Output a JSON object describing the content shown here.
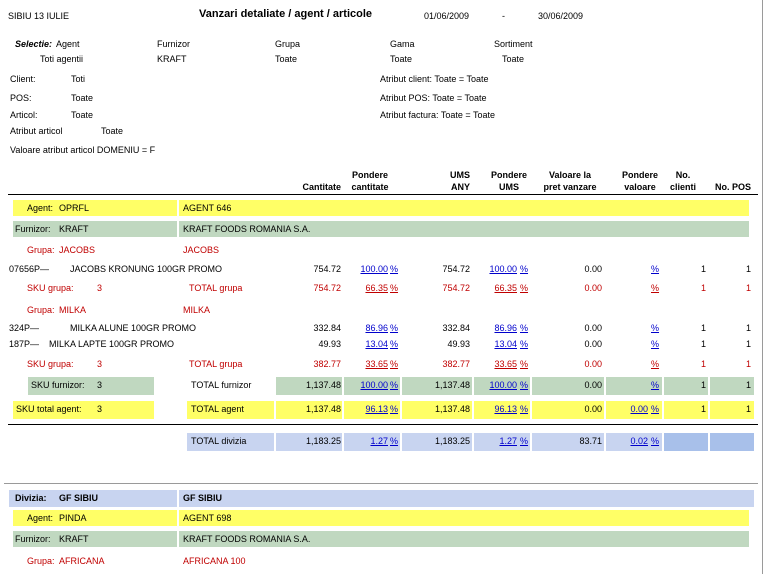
{
  "header": {
    "company": "SIBIU 13 IULIE",
    "title": "Vanzari detaliate / agent / articole",
    "date_from": "01/06/2009",
    "dash": "-",
    "date_to": "30/06/2009"
  },
  "selection": {
    "label": "Selectie:",
    "cols": [
      {
        "name": "Agent",
        "value": "Toti agentii"
      },
      {
        "name": "Furnizor",
        "value": "KRAFT"
      },
      {
        "name": "Grupa",
        "value": "Toate"
      },
      {
        "name": "Gama",
        "value": "Toate"
      },
      {
        "name": "Sortiment",
        "value": "Toate"
      }
    ]
  },
  "filters": {
    "client_label": "Client:",
    "client_value": "Toti",
    "pos_label": "POS:",
    "pos_value": "Toate",
    "articol_label": "Articol:",
    "articol_value": "Toate",
    "atr_articol_label": "Atribut articol",
    "atr_articol_value": "Toate",
    "valoare_atr": "Valoare atribut articol  DOMENIU = F",
    "atr_client": "Atribut client:  Toate = Toate",
    "atr_pos": "Atribut POS:  Toate = Toate",
    "atr_factura": "Atribut factura: Toate = Toate"
  },
  "columns": {
    "cantitate": "Cantitate",
    "pond_cant_1": "Pondere",
    "pond_cant_2": "cantitate",
    "ums_1": "UMS",
    "ums_2": "ANY",
    "pond_ums_1": "Pondere",
    "pond_ums_2": "UMS",
    "val_1": "Valoare la",
    "val_2": "pret vanzare",
    "pond_val_1": "Pondere",
    "pond_val_2": "valoare",
    "clienti_1": "No.",
    "clienti_2": "clienti",
    "pos": "No. POS"
  },
  "sec1": {
    "agent_label": "Agent:",
    "agent_code": "OPRFL",
    "agent_name": "AGENT 646",
    "furnizor_label": "Furnizor:",
    "furnizor_code": "KRAFT",
    "furnizor_name": "KRAFT FOODS ROMANIA S.A.",
    "g1_label": "Grupa:",
    "g1_code": "JACOBS",
    "g1_name": "JACOBS",
    "p1": {
      "code": "07656P—",
      "name": "JACOBS KRONUNG 100GR PROMO",
      "cant": "754.72",
      "pc": "100.00",
      "ums": "754.72",
      "pu": "100.00",
      "val": "0.00",
      "cl": "1",
      "pos": "1"
    },
    "sku1": {
      "label": "SKU grupa:",
      "n": "3",
      "total": "TOTAL grupa",
      "cant": "754.72",
      "pc": "66.35",
      "ums": "754.72",
      "pu": "66.35",
      "val": "0.00",
      "cl": "1",
      "pos": "1"
    },
    "g2_label": "Grupa:",
    "g2_code": "MILKA",
    "g2_name": "MILKA",
    "p2": {
      "code": "324P—",
      "name": "MILKA ALUNE 100GR PROMO",
      "cant": "332.84",
      "pc": "86.96",
      "ums": "332.84",
      "pu": "86.96",
      "val": "0.00",
      "cl": "1",
      "pos": "1"
    },
    "p3": {
      "code": "187P—",
      "name": "MILKA LAPTE 100GR PROMO",
      "cant": "49.93",
      "pc": "13.04",
      "ums": "49.93",
      "pu": "13.04",
      "val": "0.00",
      "cl": "1",
      "pos": "1"
    },
    "sku2": {
      "label": "SKU grupa:",
      "n": "3",
      "total": "TOTAL grupa",
      "cant": "382.77",
      "pc": "33.65",
      "ums": "382.77",
      "pu": "33.65",
      "val": "0.00",
      "cl": "1",
      "pos": "1"
    },
    "skuf": {
      "label": "SKU furnizor:",
      "n": "3",
      "total": "TOTAL furnizor",
      "cant": "1,137.48",
      "pc": "100.00",
      "ums": "1,137.48",
      "pu": "100.00",
      "val": "0.00",
      "cl": "1",
      "pos": "1"
    },
    "skua": {
      "label": "SKU total agent:",
      "n": "3",
      "total": "TOTAL agent",
      "cant": "1,137.48",
      "pc": "96.13",
      "ums": "1,137.48",
      "pu": "96.13",
      "val": "0.00",
      "pv": "0.00",
      "cl": "1",
      "pos": "1"
    },
    "div": {
      "total": "TOTAL divizia",
      "cant": "1,183.25",
      "pc": "1.27",
      "ums": "1,183.25",
      "pu": "1.27",
      "val": "83.71",
      "pv": "0.02"
    }
  },
  "pct_sign": "%",
  "sec2": {
    "div_label": "Divizia:",
    "div_code": "GF SIBIU",
    "div_name": "GF SIBIU",
    "agent_label": "Agent:",
    "agent_code": "PINDA",
    "agent_name": "AGENT 698",
    "furnizor_label": "Furnizor:",
    "furnizor_code": "KRAFT",
    "furnizor_name": "KRAFT FOODS ROMANIA S.A.",
    "g_label": "Grupa:",
    "g_code": "AFRICANA",
    "g_name": "AFRICANA 100"
  }
}
